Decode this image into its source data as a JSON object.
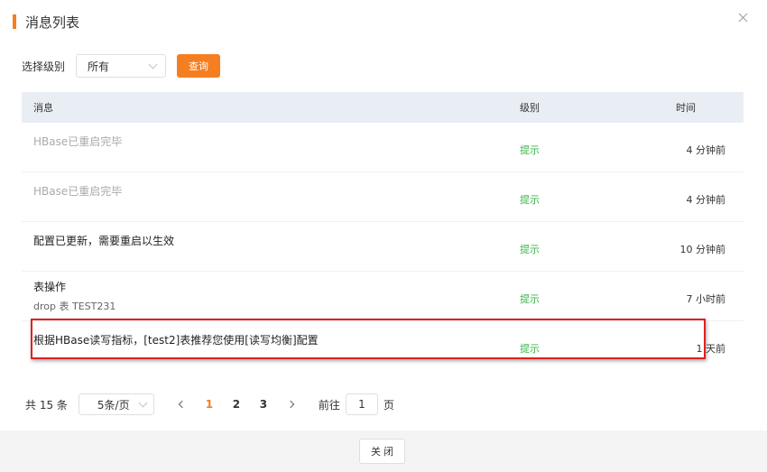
{
  "dialog": {
    "title": "消息列表",
    "close_icon": "close-icon"
  },
  "filter": {
    "label": "选择级别",
    "selected": "所有",
    "query_label": "查询"
  },
  "table": {
    "columns": [
      "消息",
      "级别",
      "时间"
    ],
    "rows": [
      {
        "title": "HBase已重启完毕",
        "subtitle": "",
        "level": "提示",
        "time": "4 分钟前"
      },
      {
        "title": "HBase已重启完毕",
        "subtitle": "",
        "level": "提示",
        "time": "4 分钟前"
      },
      {
        "title": "配置已更新，需要重启以生效",
        "subtitle": "",
        "level": "提示",
        "time": "10 分钟前"
      },
      {
        "title": "表操作",
        "subtitle": "drop 表 TEST231",
        "level": "提示",
        "time": "7 小时前"
      },
      {
        "title": "根据HBase读写指标，[test2]表推荐您使用[读写均衡]配置",
        "subtitle": "",
        "level": "提示",
        "time": "1 天前"
      }
    ]
  },
  "pagination": {
    "total": "共 15 条",
    "page_size": "5条/页",
    "pages": [
      "1",
      "2",
      "3"
    ],
    "current_page": "1",
    "goto_label": "前往",
    "goto_value": "1",
    "page_unit": "页"
  },
  "footer": {
    "close_label": "关 闭"
  },
  "colors": {
    "accent": "#f57e20",
    "level_green": "#3bb44a",
    "header_bg": "#e9eef5",
    "highlight_border": "#e02020"
  }
}
